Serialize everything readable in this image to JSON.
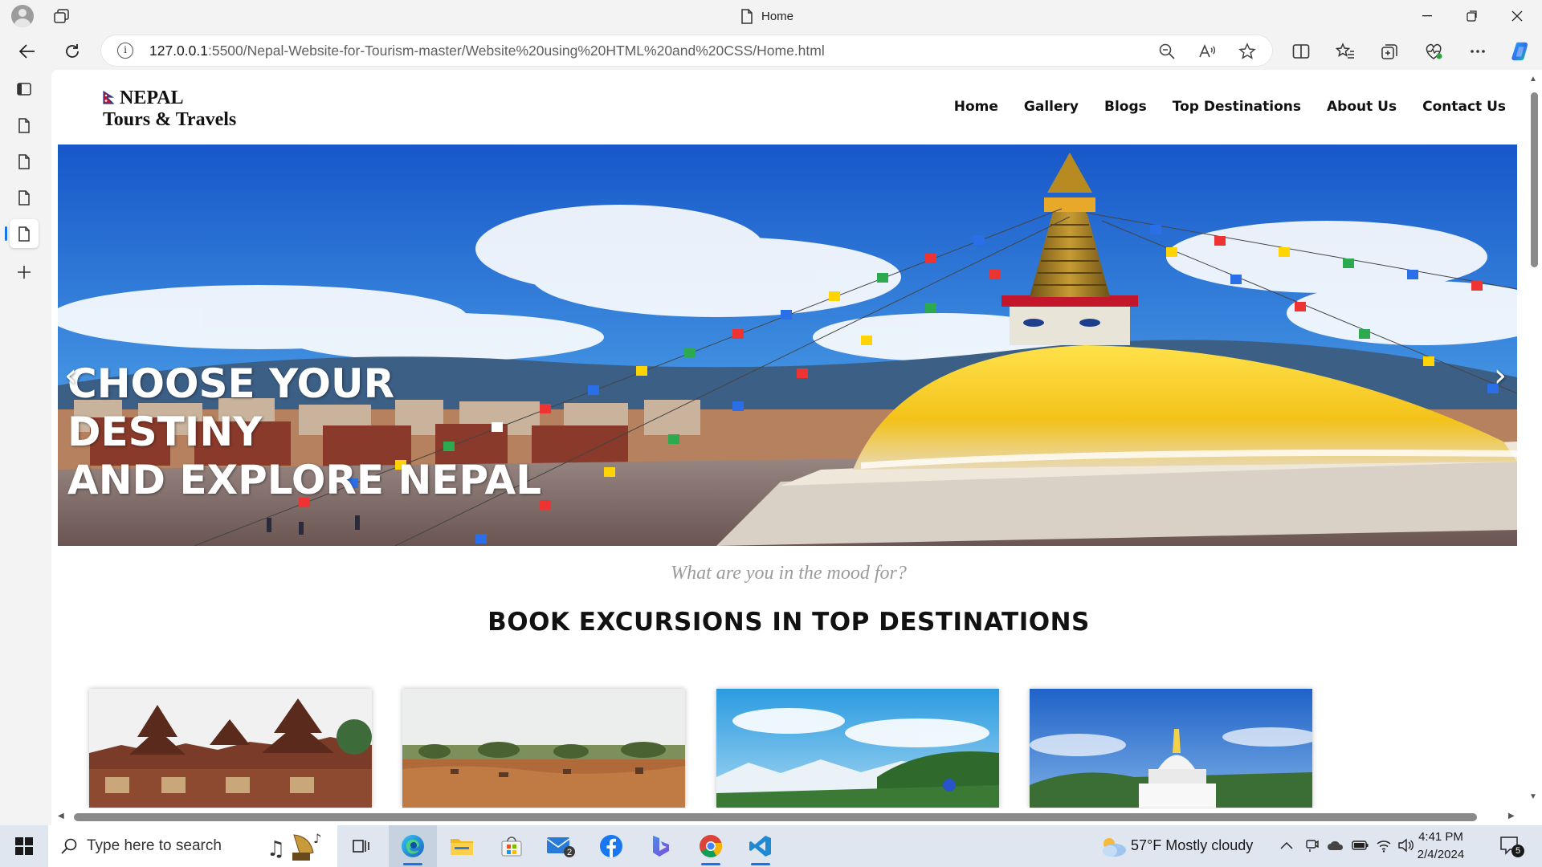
{
  "browser": {
    "tab_title": "Home",
    "url_host": "127.0.0.1",
    "url_path": ":5500/Nepal-Website-for-Tourism-master/Website%20using%20HTML%20and%20CSS/Home.html",
    "accent_color": "#1a73e8"
  },
  "site": {
    "logo_line1": "NEPAL",
    "logo_line2": "Tours & Travels",
    "nav": [
      "Home",
      "Gallery",
      "Blogs",
      "Top Destinations",
      "About Us",
      "Contact Us"
    ],
    "hero": {
      "line1": "CHOOSE YOUR",
      "line2": "DESTINY",
      "line3": "AND EXPLORE NEPAL",
      "prev_arrow": "‹",
      "next_arrow": "›"
    },
    "tagline": "What are you in the mood for?",
    "section_title": "BOOK EXCURSIONS IN TOP DESTINATIONS"
  },
  "taskbar": {
    "search_placeholder": "Type here to search",
    "mail_badge": "2",
    "weather": "57°F  Mostly cloudy",
    "time": "4:41 PM",
    "date": "2/4/2024",
    "notification_count": "5"
  }
}
